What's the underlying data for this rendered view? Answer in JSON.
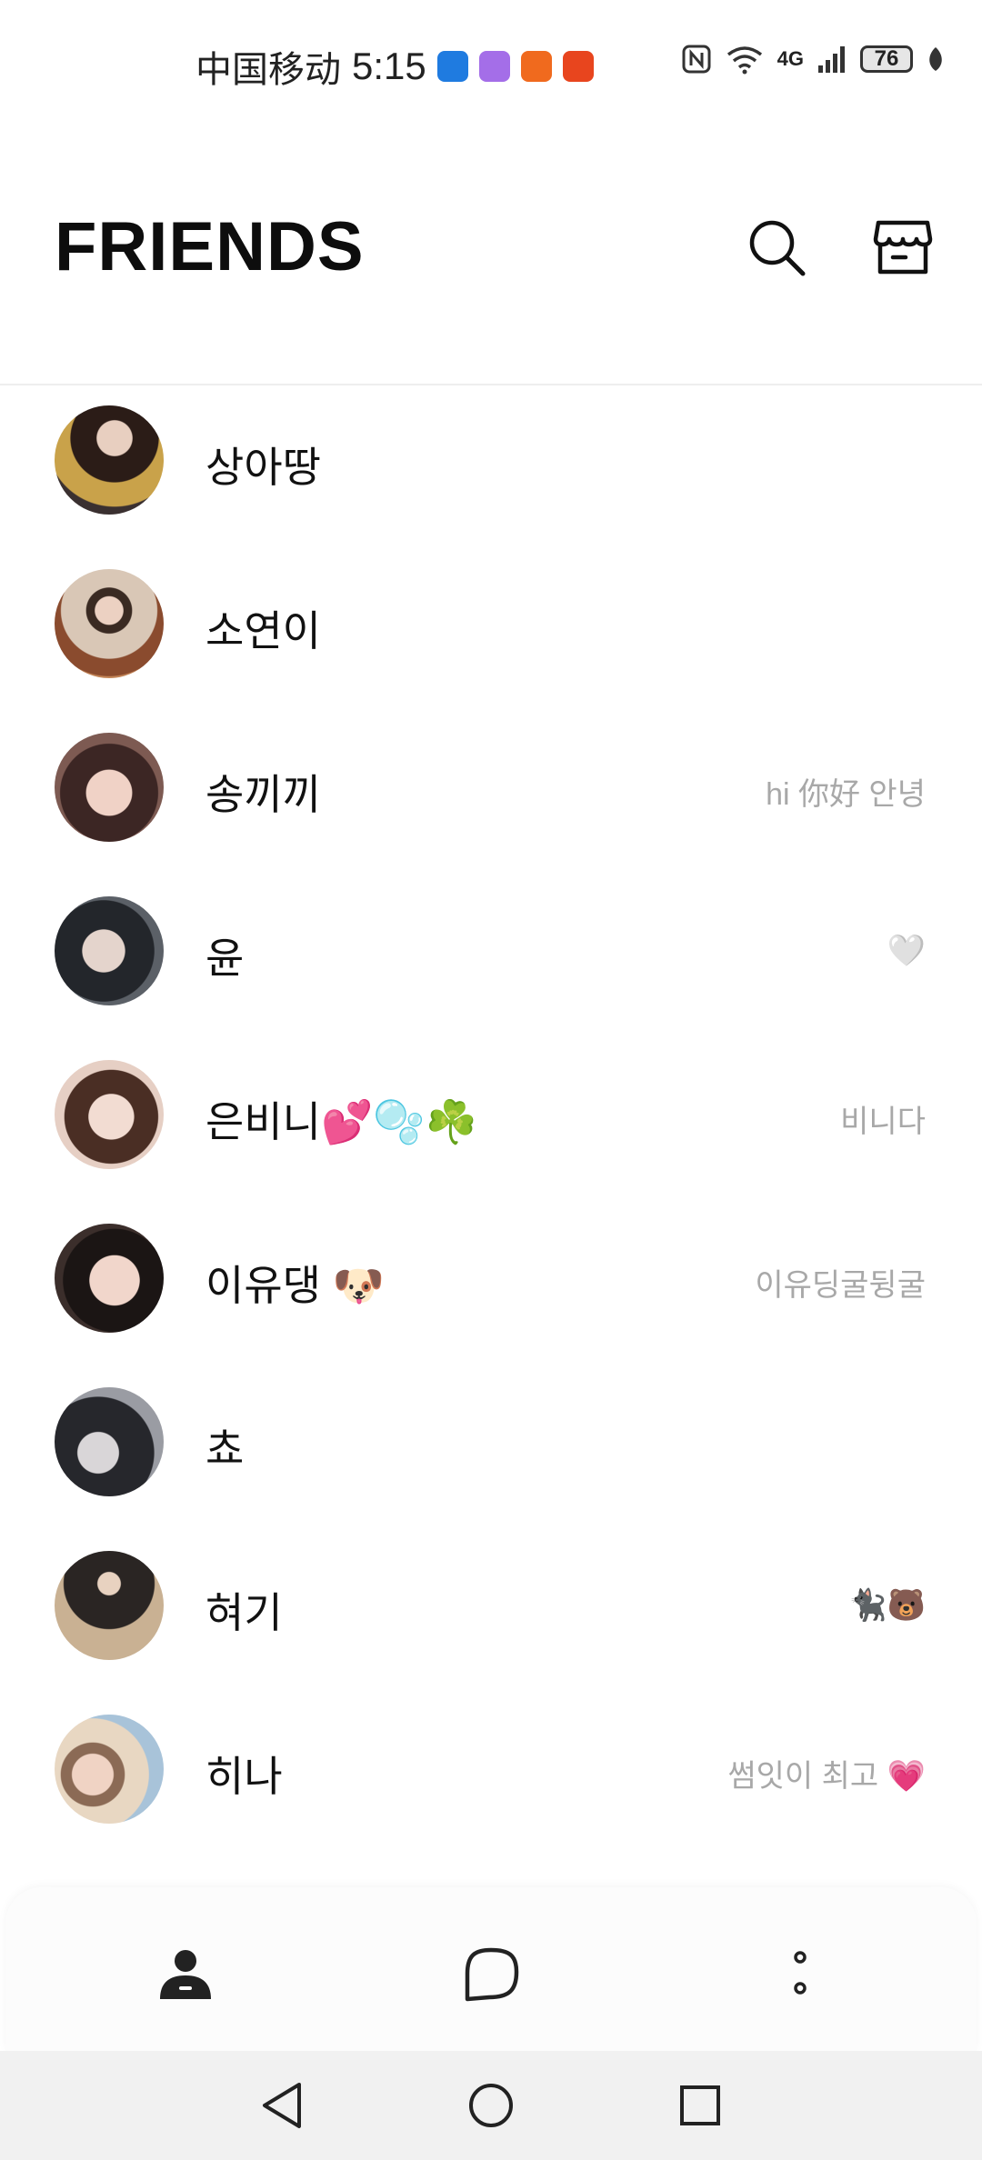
{
  "status_bar": {
    "carrier": "中国移动",
    "time": "5:15",
    "network": "4G",
    "battery": "76",
    "app_icons": [
      {
        "name": "dubble-app-icon",
        "color": "#1f7be0"
      },
      {
        "name": "purple-app-icon",
        "color": "#a46ee8"
      },
      {
        "name": "orange-app-icon",
        "color": "#f06a1e"
      },
      {
        "name": "red-app-icon",
        "color": "#e8451e"
      }
    ]
  },
  "header": {
    "title": "FRIENDS",
    "search_icon": "search-icon",
    "shop_icon": "shop-icon"
  },
  "friends": [
    {
      "name": "상아땅",
      "status": "",
      "avatar_colors": [
        "#2b1c17",
        "#c9a24a"
      ]
    },
    {
      "name": "소연이",
      "status": "",
      "avatar_colors": [
        "#d6c6b8",
        "#8a4b2e"
      ]
    },
    {
      "name": "송끼끼",
      "status": "hi 你好 안녕",
      "avatar_colors": [
        "#3c2624",
        "#e0b9ae"
      ]
    },
    {
      "name": "윤",
      "status": "🤍",
      "avatar_colors": [
        "#23262b",
        "#c8b8b0"
      ]
    },
    {
      "name": "은비니💕🫧☘️",
      "status": "비니다",
      "avatar_colors": [
        "#4a2e24",
        "#e6cfc4"
      ]
    },
    {
      "name": "이유댕 🐶",
      "status": "이유딩굴뒹굴",
      "avatar_colors": [
        "#1b1514",
        "#e2c3b8"
      ]
    },
    {
      "name": "쵸",
      "status": "",
      "avatar_colors": [
        "#26272c",
        "#9a9ca3"
      ]
    },
    {
      "name": "혀기",
      "status": "🐈‍⬛🐻",
      "avatar_colors": [
        "#c9b193",
        "#2a2523"
      ]
    },
    {
      "name": "히나",
      "status": "썸잇이 최고 💗",
      "avatar_colors": [
        "#e8d7c2",
        "#a8c3d9"
      ]
    }
  ],
  "tabbar": {
    "tabs": [
      {
        "name": "friends-tab",
        "icon": "person-icon",
        "active": true
      },
      {
        "name": "chats-tab",
        "icon": "chat-bubble-icon",
        "active": false
      },
      {
        "name": "more-tab",
        "icon": "more-dots-icon",
        "active": false
      }
    ]
  },
  "navbar": {
    "buttons": [
      "back-icon",
      "home-icon",
      "recents-icon"
    ]
  }
}
